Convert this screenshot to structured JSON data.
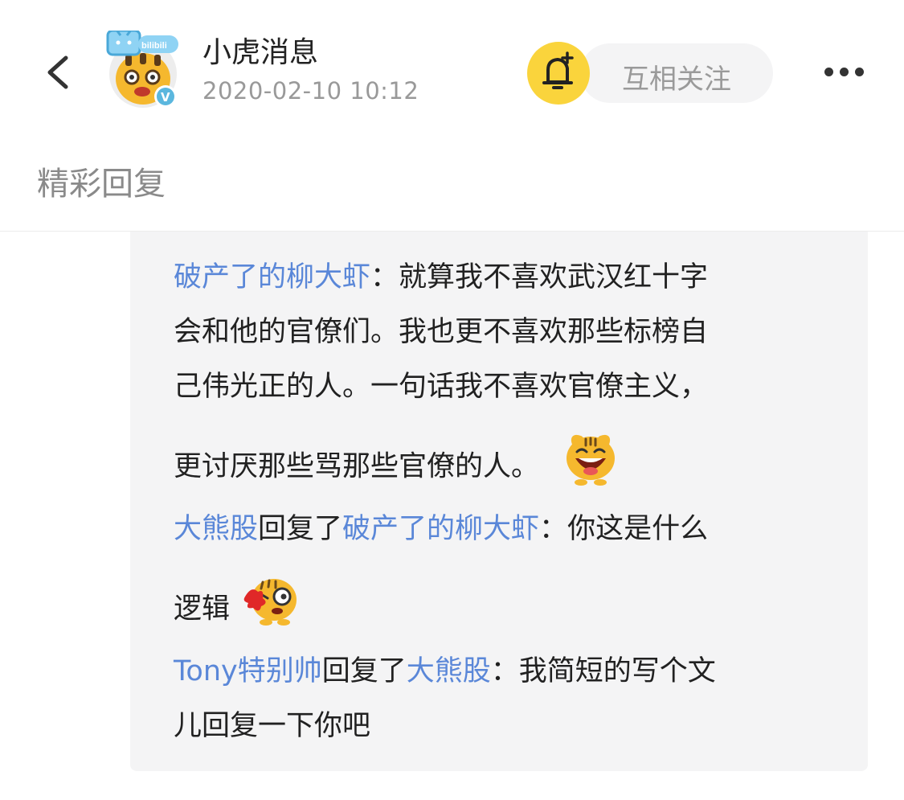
{
  "header": {
    "back_icon": "chevron-left-icon",
    "avatar_logo_text": "bilibili",
    "verified_badge": "V",
    "title": "小虎消息",
    "timestamp": "2020-02-10 10:12",
    "bell_icon": "bell-plus-icon",
    "follow_label": "互相关注",
    "more_icon": "more-horizontal-icon",
    "bell_color": "#FAD43C"
  },
  "section_title": "精彩回复",
  "colors": {
    "username": "#5A87D8",
    "reply_background": "#F4F4F5",
    "muted_text": "#999999"
  },
  "replies": [
    {
      "author": "破产了的柳大虾",
      "separator": "：",
      "lines": [
        "就算我不喜欢武汉红十字",
        "会和他的官僚们。我也更不喜欢那些标榜自",
        "己伟光正的人。一句话我不喜欢官僚主义，",
        "更讨厌那些骂那些官僚的人。"
      ],
      "emoji": "laughing-tiger-emoji"
    },
    {
      "author": "大熊股",
      "action": "回复了",
      "target": "破产了的柳大虾",
      "separator": "：",
      "lines": [
        "你这是什么",
        "逻辑"
      ],
      "emoji": "bleeding-tiger-emoji"
    },
    {
      "author": "Tony特别帅",
      "action": "回复了",
      "target": "大熊股",
      "separator": "：",
      "lines": [
        "我简短的写个文",
        "儿回复一下你吧"
      ]
    }
  ]
}
